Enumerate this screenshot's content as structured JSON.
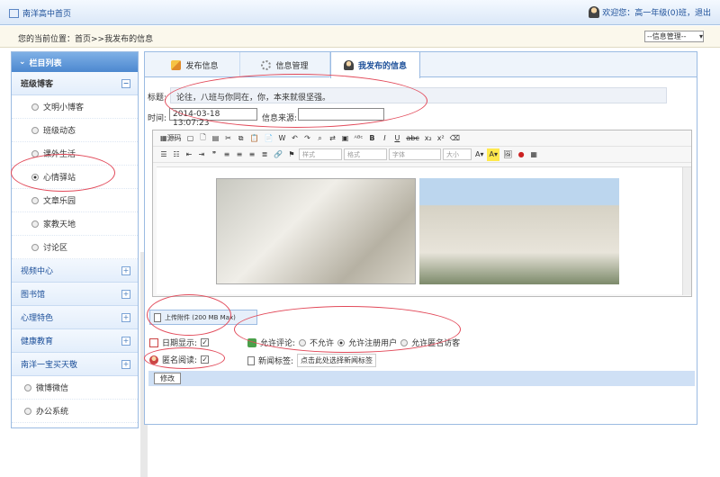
{
  "topbar": {
    "home": "南洋高中首页",
    "user": "欢迎您：高一年级(0)班，退出"
  },
  "location": {
    "text": "您的当前位置：首页>>我发布的信息",
    "manage_select": "--信息管理--"
  },
  "sidebar": {
    "title": "栏目列表",
    "group_open": "班级博客",
    "sub_items": [
      "文明小博客",
      "班级动态",
      "课外生活",
      "心情驿站",
      "文章乐园",
      "家教天地",
      "讨论区"
    ],
    "selected_index": 3,
    "groups": [
      "视频中心",
      "图书馆",
      "心理特色",
      "健康教育",
      "南洋一宝买天敬"
    ],
    "bottom_items": [
      "微博微信",
      "办公系统"
    ]
  },
  "tabs": [
    "发布信息",
    "信息管理",
    "我发布的信息"
  ],
  "form": {
    "title_label": "标题:",
    "title_value": "论往，八班与你同在，你，本来就很坚强。",
    "time_label": "时间:",
    "time_value": "2014-03-18 13:07:23",
    "source_label": "信息来源:",
    "source_value": ""
  },
  "editor": {
    "source_btn": "源码",
    "style_dd": "样式",
    "format_dd": "格式",
    "font_dd": "字体",
    "size_dd": "大小"
  },
  "upload": {
    "label": "上传附件 (200 MB Max)"
  },
  "options": {
    "date_show": "日期显示:",
    "anon_read": "匿名阅读:",
    "allow_comment": "允许评论:",
    "comment_options": [
      "不允许",
      "允许注册用户",
      "允许匿名访客"
    ],
    "comment_selected": 1,
    "news_tag": "新闻标签:",
    "tag_button": "点击此处选择新闻标签"
  },
  "submit": "修改",
  "colors": {
    "accent": "#4c88cf",
    "annotation": "#e24a5a"
  }
}
